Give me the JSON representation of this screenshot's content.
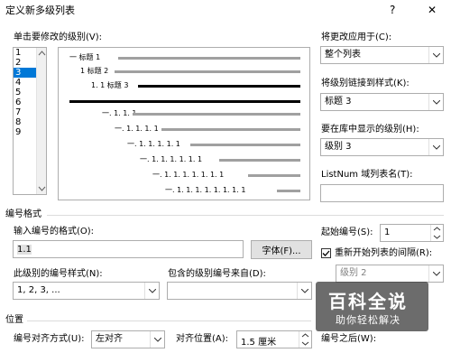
{
  "title": "定义新多级列表",
  "help": "?",
  "close": "✕",
  "level_label": "单击要修改的级别(V):",
  "levels": [
    "1",
    "2",
    "3",
    "4",
    "5",
    "6",
    "7",
    "8",
    "9"
  ],
  "selected_level": "3",
  "preview": {
    "row1": "一 标题 1",
    "row2": "1 标题 2",
    "row3": "1. 1 标题 3",
    "numbers": [
      "一. 1. 1. 1",
      "一. 1. 1. 1. 1",
      "一. 1. 1. 1. 1. 1",
      "一. 1. 1. 1. 1. 1. 1",
      "一. 1. 1. 1. 1. 1. 1. 1",
      "一. 1. 1. 1. 1. 1. 1. 1. 1"
    ]
  },
  "apply_to_label": "将更改应用于(C):",
  "apply_to_value": "整个列表",
  "link_style_label": "将级别链接到样式(K):",
  "link_style_value": "标题 3",
  "gallery_level_label": "要在库中显示的级别(H):",
  "gallery_level_value": "级别 3",
  "listnum_label": "ListNum 域列表名(T):",
  "listnum_value": "",
  "section_number_format": "编号格式",
  "enter_format_label": "输入编号的格式(O):",
  "format_value": "1.1",
  "font_button": "字体(F)...",
  "start_at_label": "起始编号(S):",
  "start_at_value": "1",
  "restart_label": "重新开始列表的间隔(R):",
  "restart_value": "级别 2",
  "number_style_label": "此级别的编号样式(N):",
  "number_style_value": "1, 2, 3, ...",
  "include_from_label": "包含的级别编号来自(D):",
  "include_from_value": "",
  "section_position": "位置",
  "alignment_label": "编号对齐方式(U):",
  "alignment_value": "左对齐",
  "aligned_at_label": "对齐位置(A):",
  "aligned_at_value": "1.5 厘米",
  "follow_label": "编号之后(W):",
  "watermark": {
    "title": "百科全说",
    "subtitle": "助你轻松解决"
  }
}
